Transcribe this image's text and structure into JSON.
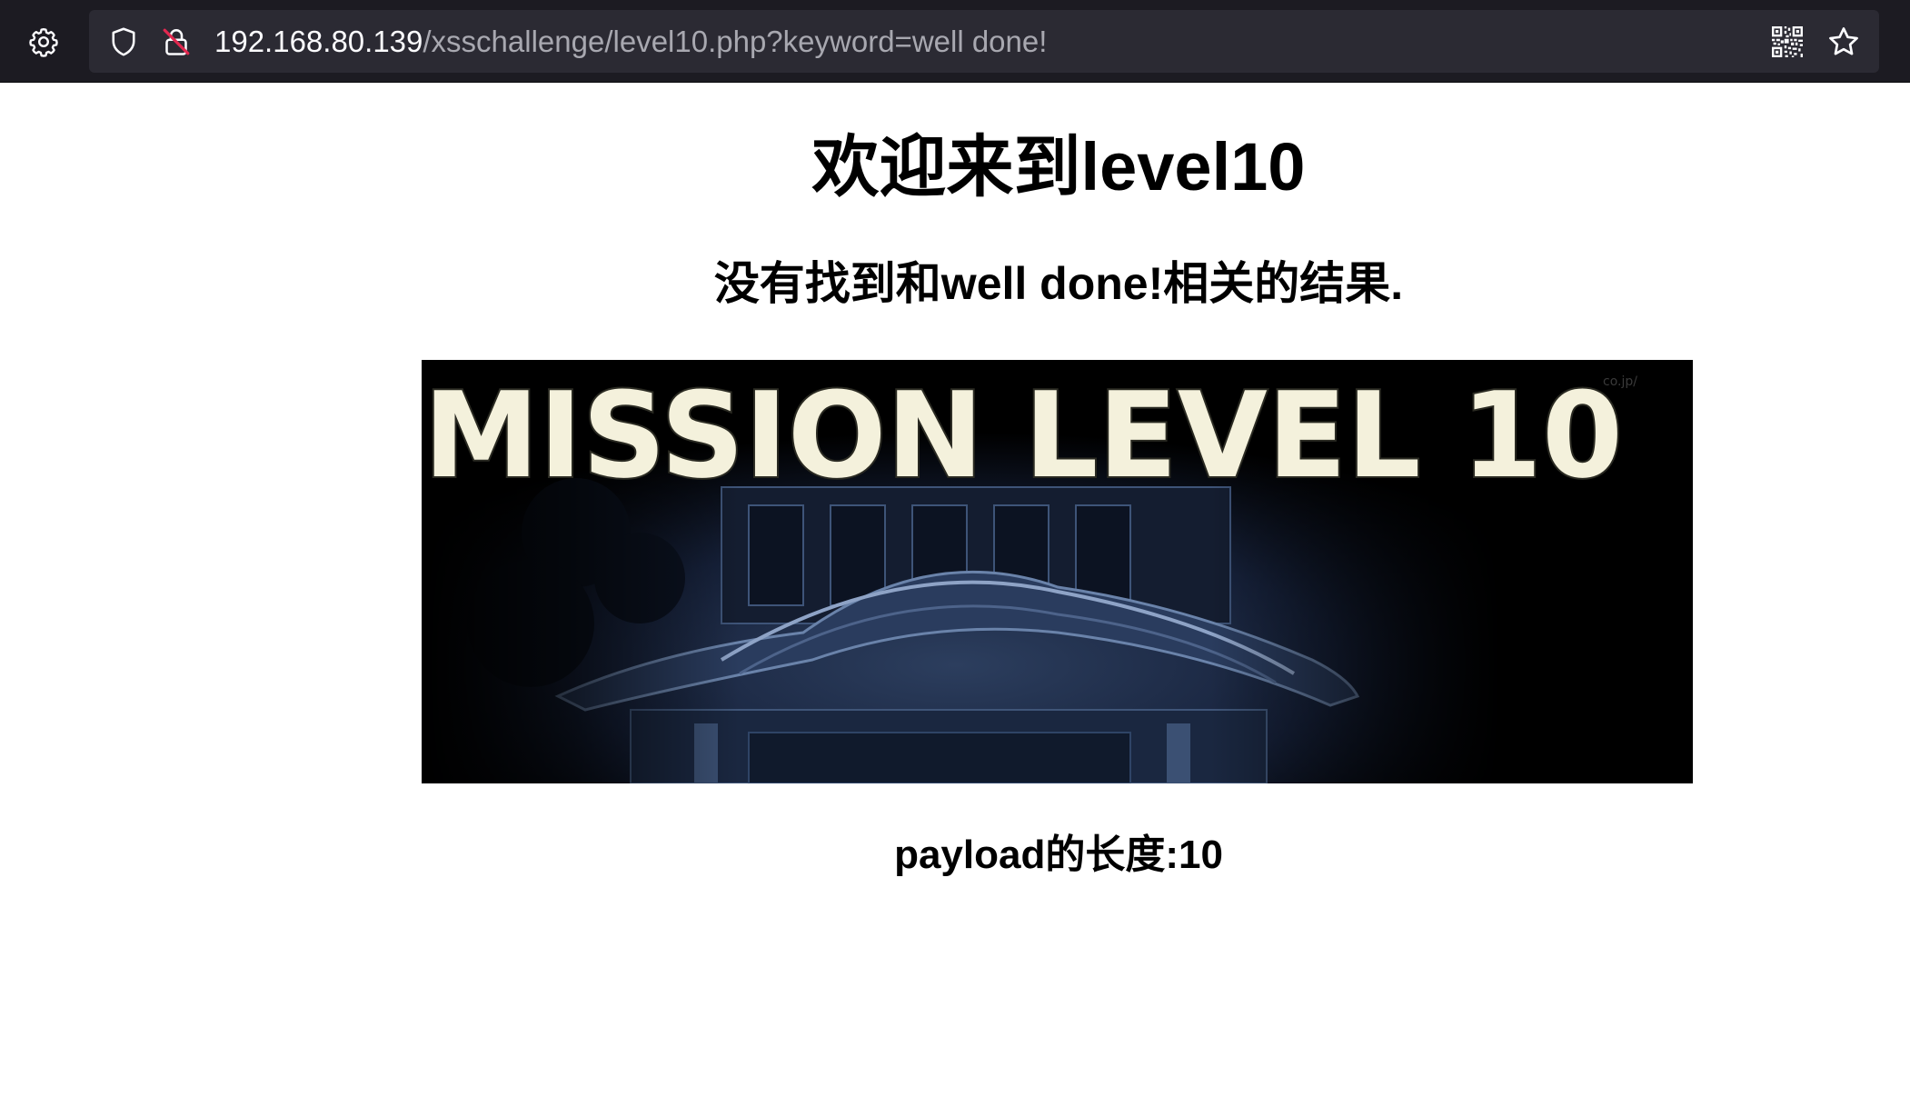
{
  "browser": {
    "url_host": "192.168.80.139",
    "url_path": "/xsschallenge/level10.php?keyword=well done!",
    "icons": {
      "settings": "gear-icon",
      "tracking_protection": "shield-icon",
      "connection": "insecure-lock-icon",
      "qr_code": "qr-code-icon",
      "bookmark": "star-icon"
    }
  },
  "page": {
    "heading": "欢迎来到level10",
    "result_text": "没有找到和well done!相关的结果.",
    "banner_text": "MISSION LEVEL 10",
    "banner_watermark": "co.jp/",
    "payload_length_text": "payload的长度:10"
  },
  "colors": {
    "toolbar_bg": "#1c1b22",
    "urlbar_bg": "#2b2a33",
    "url_host": "#fbfbfe",
    "url_path": "#a8a8b0",
    "insecure_slash": "#e22850",
    "banner_title": "#f4f1dc"
  }
}
